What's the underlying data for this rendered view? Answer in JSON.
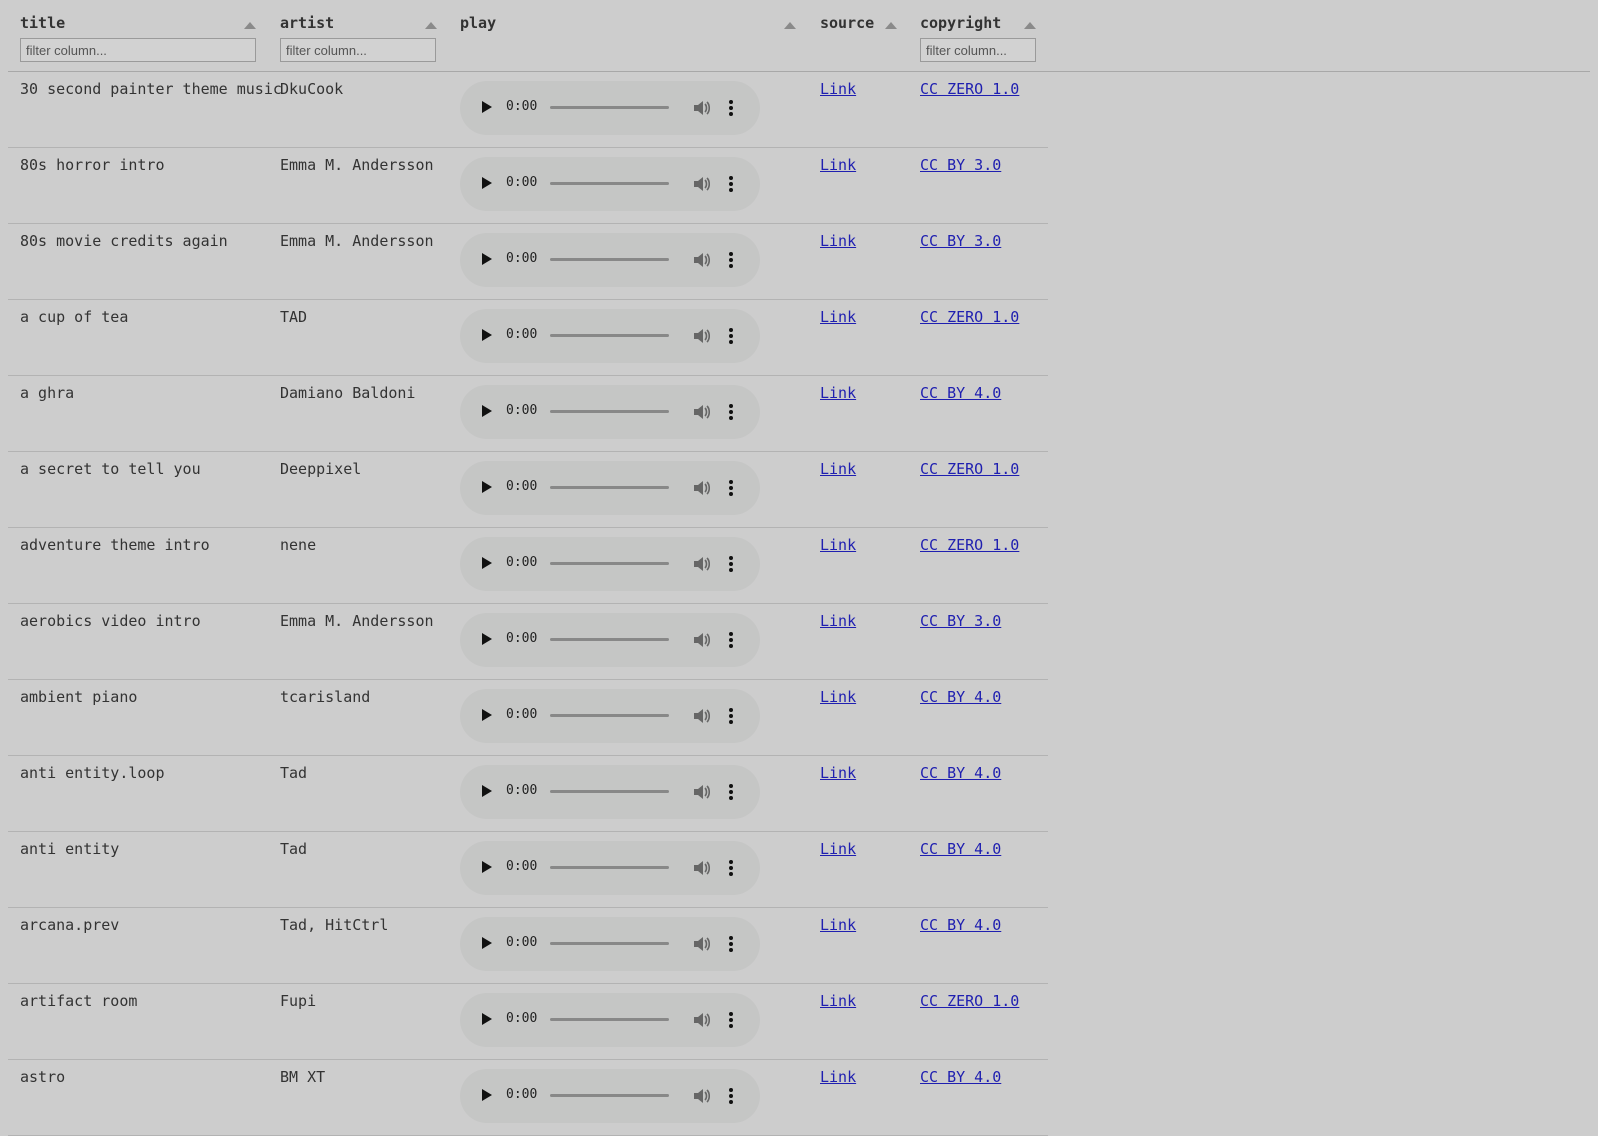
{
  "columns": {
    "title": {
      "label": "title",
      "placeholder": "filter column..."
    },
    "artist": {
      "label": "artist",
      "placeholder": "filter column..."
    },
    "play": {
      "label": "play"
    },
    "source": {
      "label": "source"
    },
    "copyright": {
      "label": "copyright",
      "placeholder": "filter column..."
    }
  },
  "player_time": "0:00",
  "rows": [
    {
      "title": "30 second painter theme music",
      "artist": "DkuCook",
      "source": "Link",
      "copyright": "CC ZERO 1.0"
    },
    {
      "title": "80s horror intro",
      "artist": "Emma M. Andersson",
      "source": "Link",
      "copyright": "CC BY 3.0"
    },
    {
      "title": "80s movie credits again",
      "artist": "Emma M. Andersson",
      "source": "Link",
      "copyright": "CC BY 3.0"
    },
    {
      "title": "a cup of tea",
      "artist": "TAD",
      "source": "Link",
      "copyright": "CC ZERO 1.0"
    },
    {
      "title": "a ghra",
      "artist": "Damiano Baldoni",
      "source": "Link",
      "copyright": "CC BY 4.0"
    },
    {
      "title": "a secret to tell you",
      "artist": "Deeppixel",
      "source": "Link",
      "copyright": "CC ZERO 1.0"
    },
    {
      "title": "adventure theme intro",
      "artist": "nene",
      "source": "Link",
      "copyright": "CC ZERO 1.0"
    },
    {
      "title": "aerobics video intro",
      "artist": "Emma M. Andersson",
      "source": "Link",
      "copyright": "CC BY 3.0"
    },
    {
      "title": "ambient piano",
      "artist": "tcarisland",
      "source": "Link",
      "copyright": "CC BY 4.0"
    },
    {
      "title": "anti entity.loop",
      "artist": "Tad",
      "source": "Link",
      "copyright": "CC BY 4.0"
    },
    {
      "title": "anti entity",
      "artist": "Tad",
      "source": "Link",
      "copyright": "CC BY 4.0"
    },
    {
      "title": "arcana.prev",
      "artist": "Tad, HitCtrl",
      "source": "Link",
      "copyright": "CC BY 4.0"
    },
    {
      "title": "artifact room",
      "artist": "Fupi",
      "source": "Link",
      "copyright": "CC ZERO 1.0"
    },
    {
      "title": "astro",
      "artist": "BM XT",
      "source": "Link",
      "copyright": "CC BY 4.0"
    }
  ]
}
